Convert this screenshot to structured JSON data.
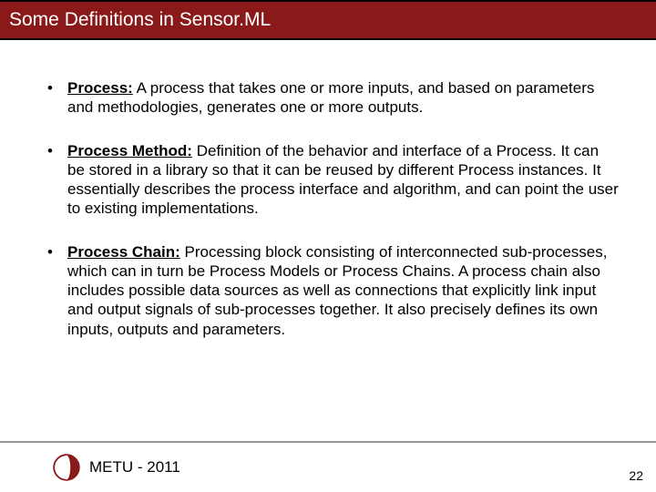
{
  "title": "Some Definitions in Sensor.ML",
  "bullets": [
    {
      "term": "Process:",
      "text": " A process that takes one or more inputs, and based on parameters and methodologies, generates one or more outputs."
    },
    {
      "term": "Process Method:",
      "text": " Definition of the behavior and interface of a Process. It can be stored in a library so that it can be reused by different Process instances. It essentially describes the process interface and algorithm, and can point the user to existing implementations."
    },
    {
      "term": "Process Chain:",
      "text": " Processing block consisting of interconnected sub-processes, which can in turn be Process Models or Process Chains. A process chain also includes possible data sources as well as connections that explicitly link input and output signals of sub-processes together. It also precisely defines its own inputs, outputs and parameters."
    }
  ],
  "footer": {
    "text": "METU - 2011",
    "page": "22"
  },
  "colors": {
    "accent": "#8a1a1a"
  }
}
